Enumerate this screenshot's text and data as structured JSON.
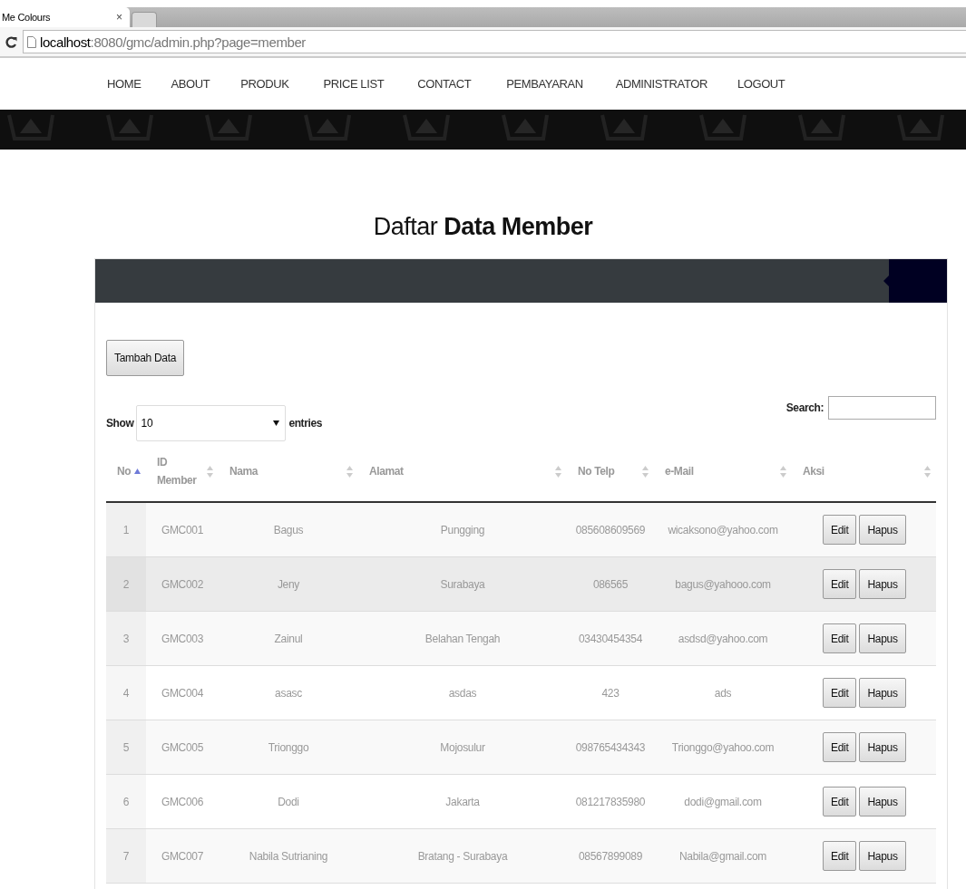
{
  "browser": {
    "tab_title": "Me Colours",
    "tab_close": "×",
    "url_host": "localhost",
    "url_rest": ":8080/gmc/admin.php?page=member"
  },
  "nav": [
    "HOME",
    "ABOUT",
    "PRODUK",
    "PRICE LIST",
    "CONTACT",
    "PEMBAYARAN",
    "ADMINISTRATOR",
    "LOGOUT"
  ],
  "title": "Daftar **Data Member**",
  "add_button": "Tambah Data",
  "length": {
    "show": "Show",
    "value": "10",
    "entries": "entries"
  },
  "search": {
    "label": "Search:"
  },
  "columns": [
    {
      "label": "No",
      "sorted": true
    },
    {
      "label": "ID Member",
      "sorted": false
    },
    {
      "label": "Nama",
      "sorted": false
    },
    {
      "label": "Alamat",
      "sorted": false
    },
    {
      "label": "No Telp",
      "sorted": false
    },
    {
      "label": "e-Mail",
      "sorted": false
    },
    {
      "label": "Aksi",
      "sorted": false
    }
  ],
  "rows": [
    {
      "cells": [
        "1",
        "GMC001",
        "Bagus",
        "Pungging",
        "085608609569",
        "wicaksono@yahoo.com"
      ],
      "hovered": false,
      "actions": [
        "Edit",
        "Hapus"
      ]
    },
    {
      "cells": [
        "2",
        "GMC002",
        "Jeny",
        "Surabaya",
        "086565",
        "bagus@yahooo.com"
      ],
      "hovered": true,
      "actions": [
        "Edit",
        "Hapus"
      ]
    },
    {
      "cells": [
        "3",
        "GMC003",
        "Zainul",
        "Belahan Tengah",
        "03430454354",
        "asdsd@yahoo.com"
      ],
      "hovered": false,
      "actions": [
        "Edit",
        "Hapus"
      ]
    },
    {
      "cells": [
        "4",
        "GMC004",
        "asasc",
        "asdas",
        "423",
        "ads"
      ],
      "hovered": false,
      "actions": [
        "Edit",
        "Hapus"
      ]
    },
    {
      "cells": [
        "5",
        "GMC005",
        "Trionggo",
        "Mojosulur",
        "098765434343",
        "Trionggo@yahoo.com"
      ],
      "hovered": false,
      "actions": [
        "Edit",
        "Hapus"
      ]
    },
    {
      "cells": [
        "6",
        "GMC006",
        "Dodi",
        "Jakarta",
        "081217835980",
        "dodi@gmail.com"
      ],
      "hovered": false,
      "actions": [
        "Edit",
        "Hapus"
      ]
    },
    {
      "cells": [
        "7",
        "GMC007",
        "Nabila Sutrianing",
        "Bratang - Surabaya",
        "08567899089",
        "Nabila@gmail.com"
      ],
      "hovered": false,
      "actions": [
        "Edit",
        "Hapus"
      ]
    }
  ]
}
